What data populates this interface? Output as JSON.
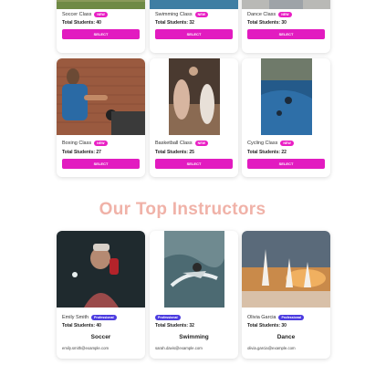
{
  "classes_top": [
    {
      "name": "Soccer Class",
      "badge": "NEW",
      "students": "Total Students: 40",
      "button": "SELECT"
    },
    {
      "name": "Swimming Class",
      "badge": "NEW",
      "students": "Total Students: 32",
      "button": "SELECT"
    },
    {
      "name": "Dance Class",
      "badge": "NEW",
      "students": "Total Students: 30",
      "button": "SELECT"
    }
  ],
  "classes": [
    {
      "name": "Boxing Class",
      "badge": "NEW",
      "students": "Total Students: 27",
      "button": "SELECT"
    },
    {
      "name": "Basketball Class",
      "badge": "NEW",
      "students": "Total Students: 25",
      "button": "SELECT"
    },
    {
      "name": "Cycling Class",
      "badge": "NEW",
      "students": "Total Students: 22",
      "button": "SELECT"
    }
  ],
  "instructors_heading": "Our Top Instructors",
  "instructors": [
    {
      "name": "Emily Smith",
      "badge": "Professional",
      "students": "Total Students: 40",
      "sport": "Soccer",
      "email": "emily.smith@example.com"
    },
    {
      "name": "",
      "badge": "Professional",
      "students": "Total Students: 32",
      "sport": "Swimming",
      "email": "sarah.davis@example.com"
    },
    {
      "name": "Olivia Garcia",
      "badge": "Professional",
      "students": "Total Students: 30",
      "sport": "Dance",
      "email": "olivia.garcia@example.com"
    }
  ],
  "colors": {
    "accent": "#e21bc0",
    "heading": "#f0b2a8",
    "professional_badge": "#4b3be0"
  }
}
